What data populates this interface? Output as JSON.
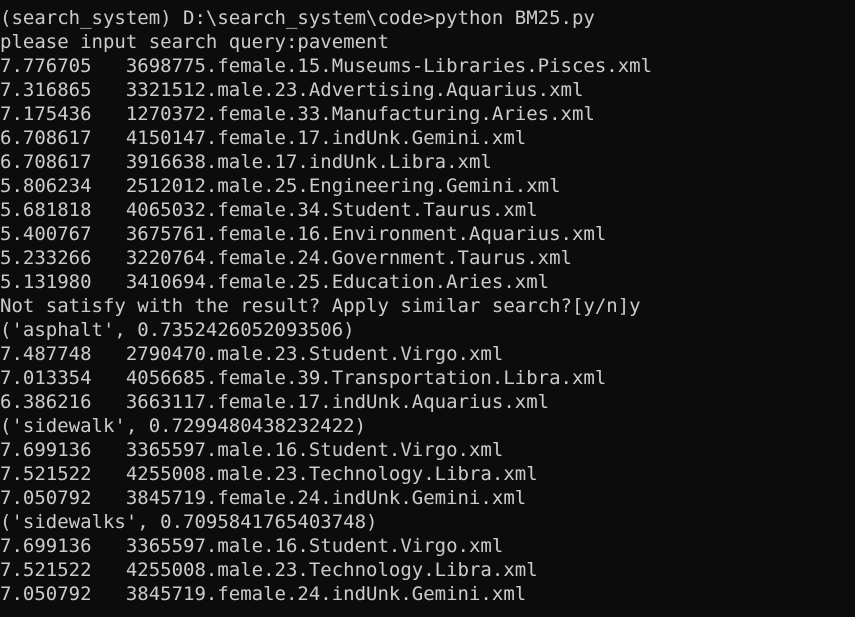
{
  "terminal": {
    "lines": [
      "(search_system) D:\\search_system\\code>python BM25.py",
      "please input search query:pavement",
      "7.776705   3698775.female.15.Museums-Libraries.Pisces.xml",
      "7.316865   3321512.male.23.Advertising.Aquarius.xml",
      "7.175436   1270372.female.33.Manufacturing.Aries.xml",
      "6.708617   4150147.female.17.indUnk.Gemini.xml",
      "6.708617   3916638.male.17.indUnk.Libra.xml",
      "5.806234   2512012.male.25.Engineering.Gemini.xml",
      "5.681818   4065032.female.34.Student.Taurus.xml",
      "5.400767   3675761.female.16.Environment.Aquarius.xml",
      "5.233266   3220764.female.24.Government.Taurus.xml",
      "5.131980   3410694.female.25.Education.Aries.xml",
      "Not satisfy with the result? Apply similar search?[y/n]y",
      "('asphalt', 0.7352426052093506)",
      "7.487748   2790470.male.23.Student.Virgo.xml",
      "7.013354   4056685.female.39.Transportation.Libra.xml",
      "6.386216   3663117.female.17.indUnk.Aquarius.xml",
      "('sidewalk', 0.7299480438232422)",
      "7.699136   3365597.male.16.Student.Virgo.xml",
      "7.521522   4255008.male.23.Technology.Libra.xml",
      "7.050792   3845719.female.24.indUnk.Gemini.xml",
      "('sidewalks', 0.7095841765403748)",
      "7.699136   3365597.male.16.Student.Virgo.xml",
      "7.521522   4255008.male.23.Technology.Libra.xml",
      "7.050792   3845719.female.24.indUnk.Gemini.xml"
    ]
  },
  "colors": {
    "background": "#0c0c0c",
    "text": "#cccccc"
  }
}
